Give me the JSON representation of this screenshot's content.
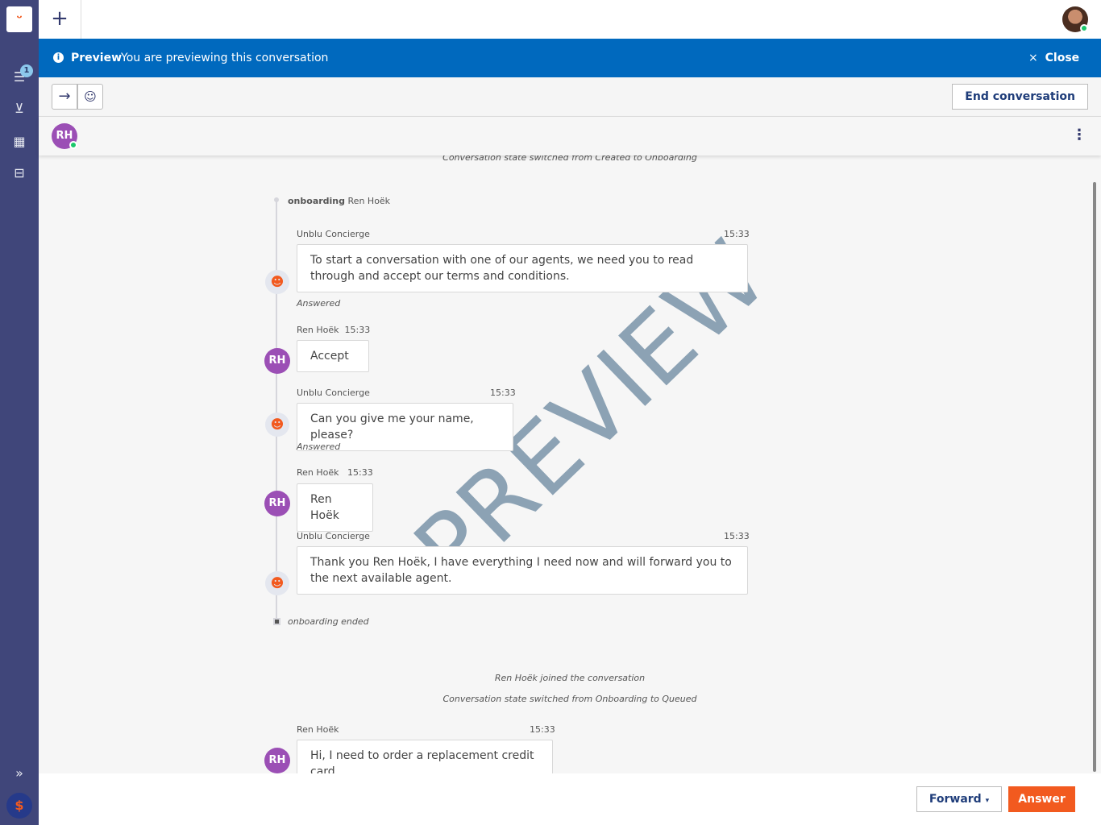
{
  "sidebar": {
    "badge_count": "1",
    "items": [
      "conversations-icon",
      "inbox-icon",
      "calendar-icon",
      "archive-icon"
    ]
  },
  "banner": {
    "title": "Preview",
    "text": "You are previewing this conversation",
    "close": "Close"
  },
  "toolbar": {
    "end": "End conversation"
  },
  "participant": {
    "initials": "RH"
  },
  "watermark": "PREVIEW",
  "conversation": {
    "sys_top": "Conversation state switched from Created to Onboarding",
    "onboarding_label": "onboarding",
    "onboarding_name": "Ren Hoëk",
    "messages": [
      {
        "sender": "Unblu Concierge",
        "time": "15:33",
        "text": "To start a conversation with one of our agents, we need you to read through and accept our terms and conditions.",
        "status": "Answered"
      },
      {
        "sender": "Ren Hoëk",
        "time": "15:33",
        "text": "Accept"
      },
      {
        "sender": "Unblu Concierge",
        "time": "15:33",
        "text": "Can you give me your name, please?",
        "status": "Answered"
      },
      {
        "sender": "Ren Hoëk",
        "time": "15:33",
        "text": "Ren Hoëk"
      },
      {
        "sender": "Unblu Concierge",
        "time": "15:33",
        "text": "Thank you Ren Hoëk, I have everything I need now and will forward you to the next available agent."
      },
      {
        "sender": "Ren Hoëk",
        "time": "15:33",
        "text": "Hi, I need to order a replacement credit card"
      }
    ],
    "onboarding_ended": "onboarding ended",
    "sys_joined": "Ren Hoëk joined the conversation",
    "sys_queued": "Conversation state switched from Onboarding to Queued"
  },
  "footer": {
    "forward": "Forward",
    "answer": "Answer"
  },
  "colors": {
    "sidebar": "#40467a",
    "banner": "#0069be",
    "accent": "#f25a1f",
    "avatar": "#9b4fb5"
  }
}
